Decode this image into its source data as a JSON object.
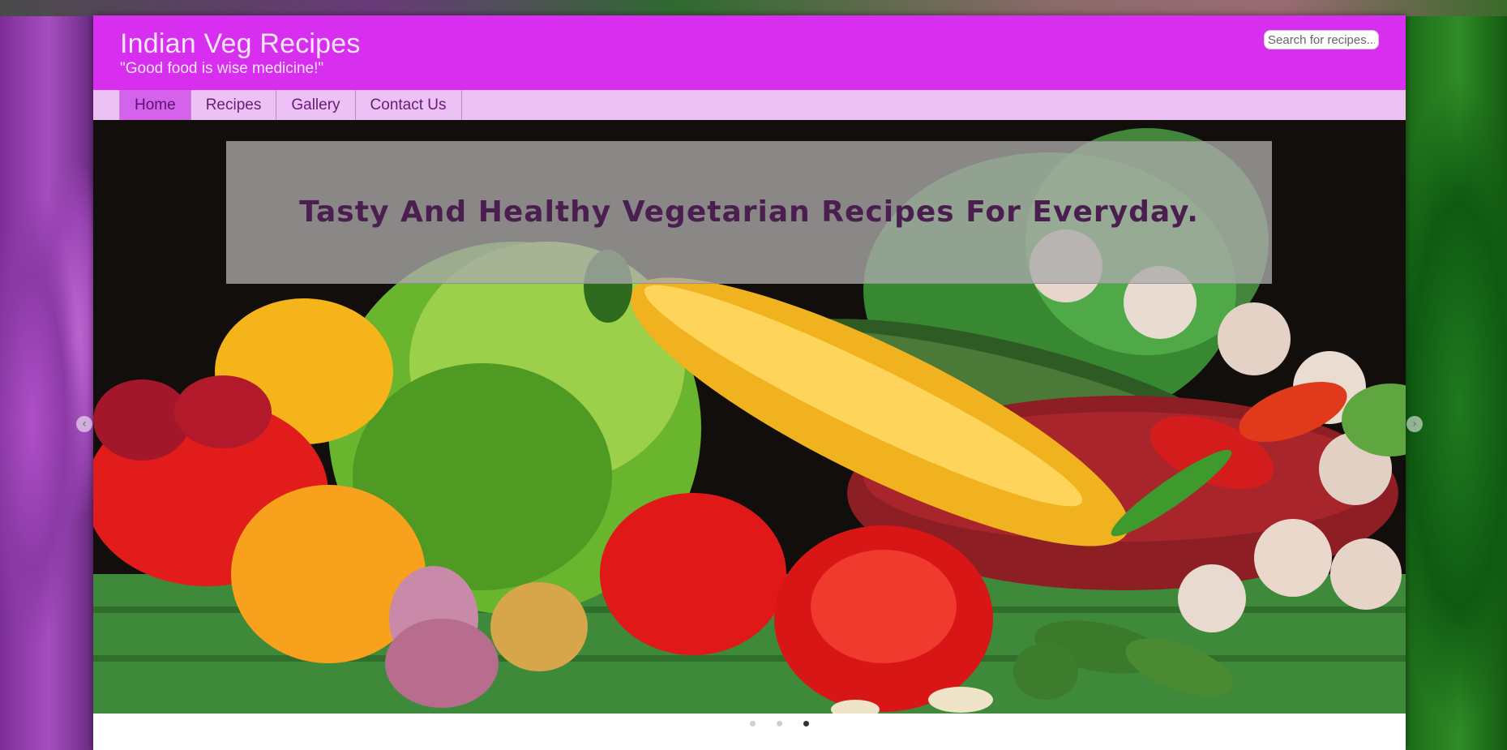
{
  "header": {
    "title": "Indian Veg Recipes",
    "tagline": "\"Good food is wise medicine!\"",
    "search_placeholder": "Search for recipes..."
  },
  "nav": {
    "items": [
      {
        "label": "Home",
        "active": true
      },
      {
        "label": "Recipes",
        "active": false
      },
      {
        "label": "Gallery",
        "active": false
      },
      {
        "label": "Contact Us",
        "active": false
      }
    ]
  },
  "slider": {
    "banner_text": "Tasty And Healthy Vegetarian  Recipes For Everyday.",
    "slide_count": 3,
    "active_slide": 3,
    "prev_icon": "chevron-left-icon",
    "next_icon": "chevron-right-icon"
  },
  "colors": {
    "header_bg": "#d82ef0",
    "nav_bg": "#ecc1f3",
    "nav_active_bg": "#d462ea",
    "nav_text": "#6b1a7a",
    "banner_text": "#4a1e4f"
  }
}
